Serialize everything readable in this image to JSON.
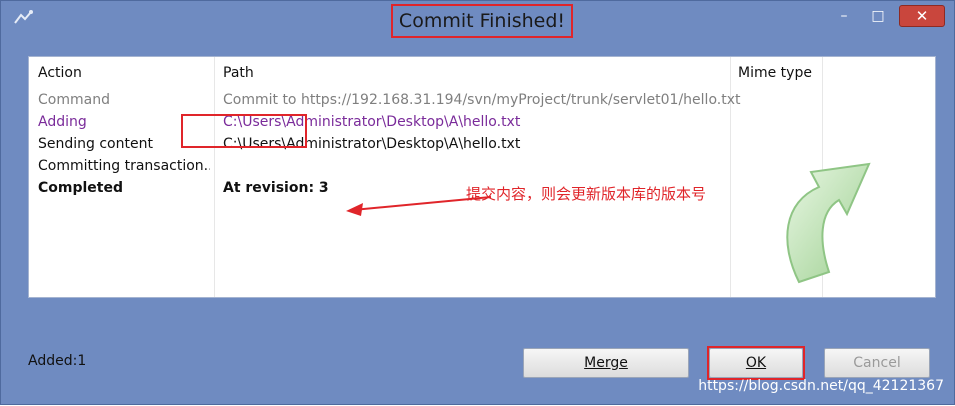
{
  "window": {
    "title": "Commit Finished!",
    "controls": {
      "minimize": "–",
      "maximize": "□",
      "close": "✕"
    }
  },
  "table": {
    "headers": [
      "Action",
      "Path",
      "Mime type"
    ],
    "rows": [
      {
        "action": "Command",
        "path": "Commit to https://192.168.31.194/svn/myProject/trunk/servlet01/hello.txt"
      },
      {
        "action": "Adding",
        "path": "C:\\Users\\Administrator\\Desktop\\A\\hello.txt"
      },
      {
        "action": "Sending content",
        "path": "C:\\Users\\Administrator\\Desktop\\A\\hello.txt"
      },
      {
        "action": "Committing transaction...",
        "path": ""
      },
      {
        "action": "Completed",
        "path": "At revision: 3"
      }
    ]
  },
  "annotation": {
    "text": "提交内容，则会更新版本库的版本号"
  },
  "status": {
    "added": "Added:1"
  },
  "buttons": {
    "merge": "Merge",
    "ok": "OK",
    "cancel": "Cancel"
  },
  "watermark": "https://blog.csdn.net/qq_42121367",
  "colors": {
    "window_bg": "#6f8bc1",
    "highlight": "#e0252a",
    "adding_text": "#7a2b9a"
  },
  "icons": {
    "app": "tortoisesvn-icon",
    "completion": "green-curved-arrow-icon"
  }
}
